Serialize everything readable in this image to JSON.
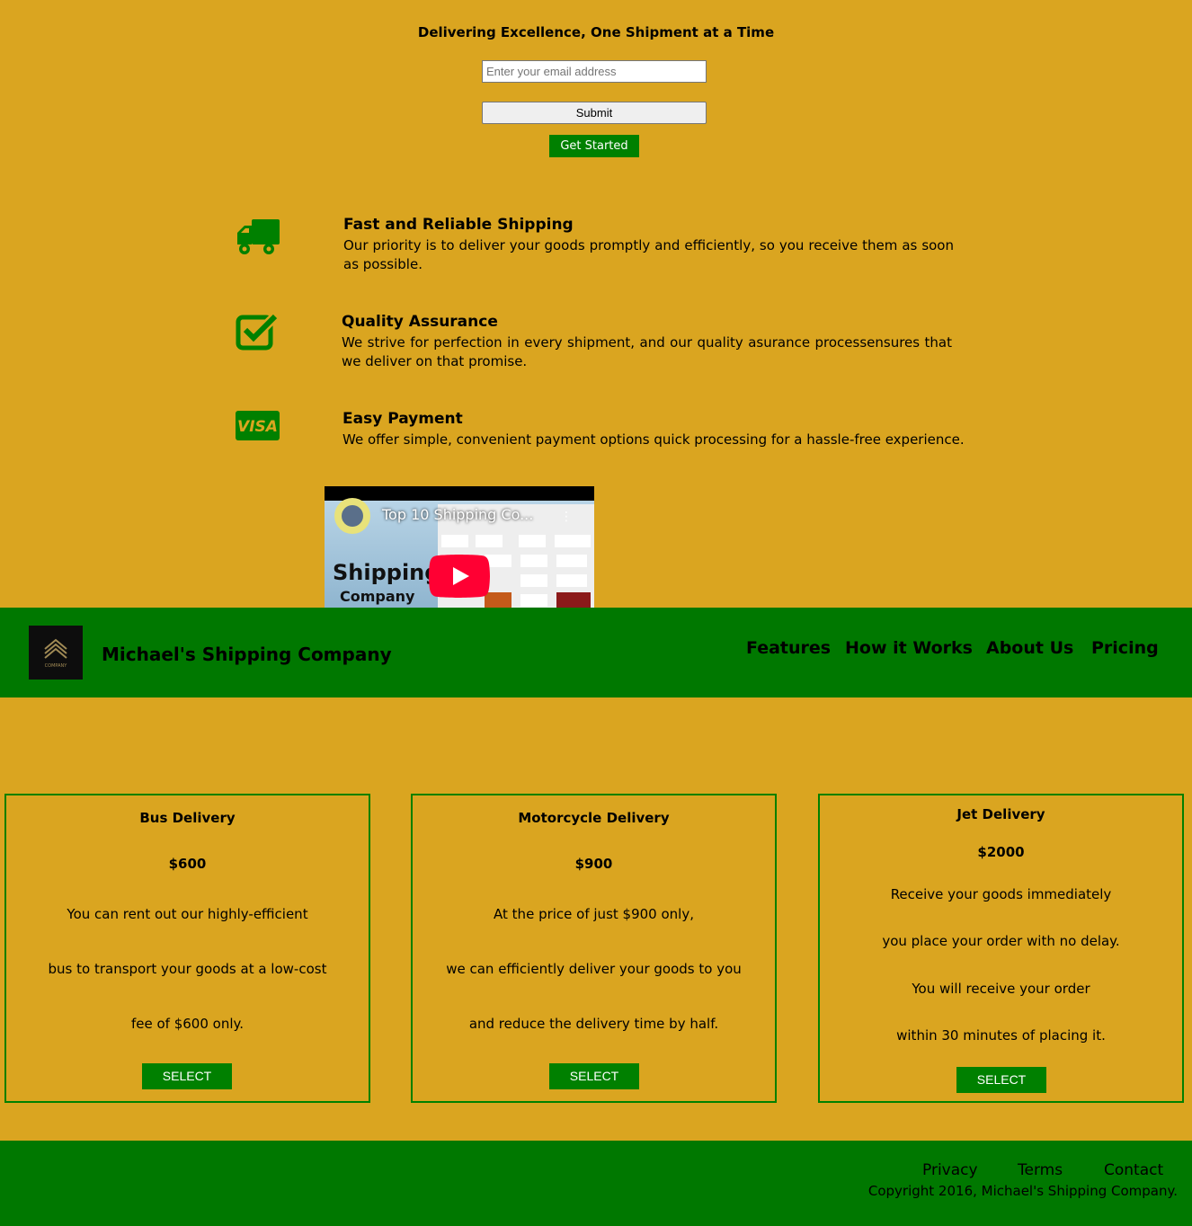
{
  "hero": {
    "tagline": "Delivering Excellence, One Shipment at a Time",
    "email_placeholder": "Enter your email address",
    "submit_label": "Submit",
    "get_started_label": "Get Started"
  },
  "features": [
    {
      "icon": "truck-icon",
      "title": "Fast and Reliable Shipping",
      "text": "Our priority is to deliver your goods promptly and efficiently, so you receive them as soon as possible."
    },
    {
      "icon": "check-square-icon",
      "title": "Quality Assurance",
      "text": "We strive for perfection in every shipment, and our quality asurance processensures that we deliver on that promise."
    },
    {
      "icon": "visa-icon",
      "title": "Easy Payment",
      "text": "We offer simple, convenient payment options quick processing for a hassle-free experience."
    }
  ],
  "video": {
    "title": "Top 10 Shipping Co...",
    "thumb_line1": "Shipping",
    "thumb_line2": "Company"
  },
  "header": {
    "brand": "Michael's Shipping Company",
    "logo_text": "COMPANY",
    "nav": [
      "Features",
      "How it Works",
      "About Us",
      "Pricing"
    ]
  },
  "pricing": [
    {
      "name": "Bus Delivery",
      "price": "$600",
      "lines": [
        "You can rent out our highly-efficient",
        "bus to transport your goods at a low-cost",
        "fee of $600 only."
      ],
      "button": "SELECT"
    },
    {
      "name": "Motorcycle Delivery",
      "price": "$900",
      "lines": [
        "At the price of just $900 only,",
        "we can efficiently deliver your goods to you",
        "and reduce the delivery time by half."
      ],
      "button": "SELECT"
    },
    {
      "name": "Jet Delivery",
      "price": "$2000",
      "lines": [
        "Receive your goods immediately",
        "you place your order with no delay.",
        "You will receive your order",
        "within 30 minutes of placing it."
      ],
      "button": "SELECT"
    }
  ],
  "footer": {
    "links": [
      "Privacy",
      "Terms",
      "Contact"
    ],
    "copyright": "Copyright 2016, Michael's Shipping Company."
  },
  "colors": {
    "background": "#DAA520",
    "accent_green": "#008000"
  }
}
